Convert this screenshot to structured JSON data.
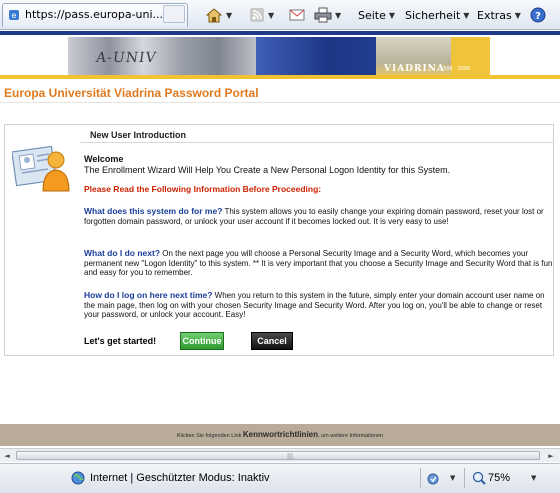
{
  "browser": {
    "tab_title": "https://pass.europa-uni...",
    "toolbar": {
      "page_label": "Seite",
      "security_label": "Sicherheit",
      "extras_label": "Extras"
    }
  },
  "banner": {
    "photo_text": "A-UNIV",
    "brand": "VIADRINA",
    "years": "1506 · 2006"
  },
  "portal": {
    "title": "Europa Universität Viadrina Password Portal"
  },
  "intro": {
    "section_title": "New User Introduction",
    "welcome": "Welcome",
    "welcome_text": "The Enrollment Wizard Will Help You Create a New Personal Logon Identity for this System.",
    "please_read": "Please Read the Following Information Before Proceeding:",
    "items": [
      {
        "question": "What does this system do for me?",
        "answer": " This system allows you to easily change your expiring domain password, reset your lost or forgotten domain password, or unlock your user account if it becomes locked out. It is very easy to use!"
      },
      {
        "question": "What do I do next?",
        "answer": "  On the next page you will choose a Personal Security Image and a Security Word, which becomes your permanent new \"Logon Identity\" to this system. ** It is very important that you choose a Security Image and Security Word that is fun and easy for you to remember."
      },
      {
        "question": "How do I log on here next time?",
        "answer": " When you return to this system in the future, simply enter your domain account user name on the main page, then log on with your chosen Security Image and Security Word. After you log on, you'll be able to change or reset your password, or unlock your account. Easy!"
      }
    ],
    "lets_get_started": "Let's get started!",
    "continue_label": "Continue",
    "cancel_label": "Cancel"
  },
  "footer": {
    "prefix": "Klicken Sie folgenden Link ",
    "link": "Kennwortrichtlinien",
    "suffix": ", um weitere Informationen"
  },
  "statusbar": {
    "zone_text": "Internet | Geschützter Modus: Inaktiv",
    "zoom": "75%"
  },
  "colors": {
    "portal_title": "#e07a1f",
    "warning_red": "#cc2200",
    "question_blue": "#1a3d99",
    "continue_green": "#2f9a2f",
    "footer_bg": "#b9ab99"
  }
}
